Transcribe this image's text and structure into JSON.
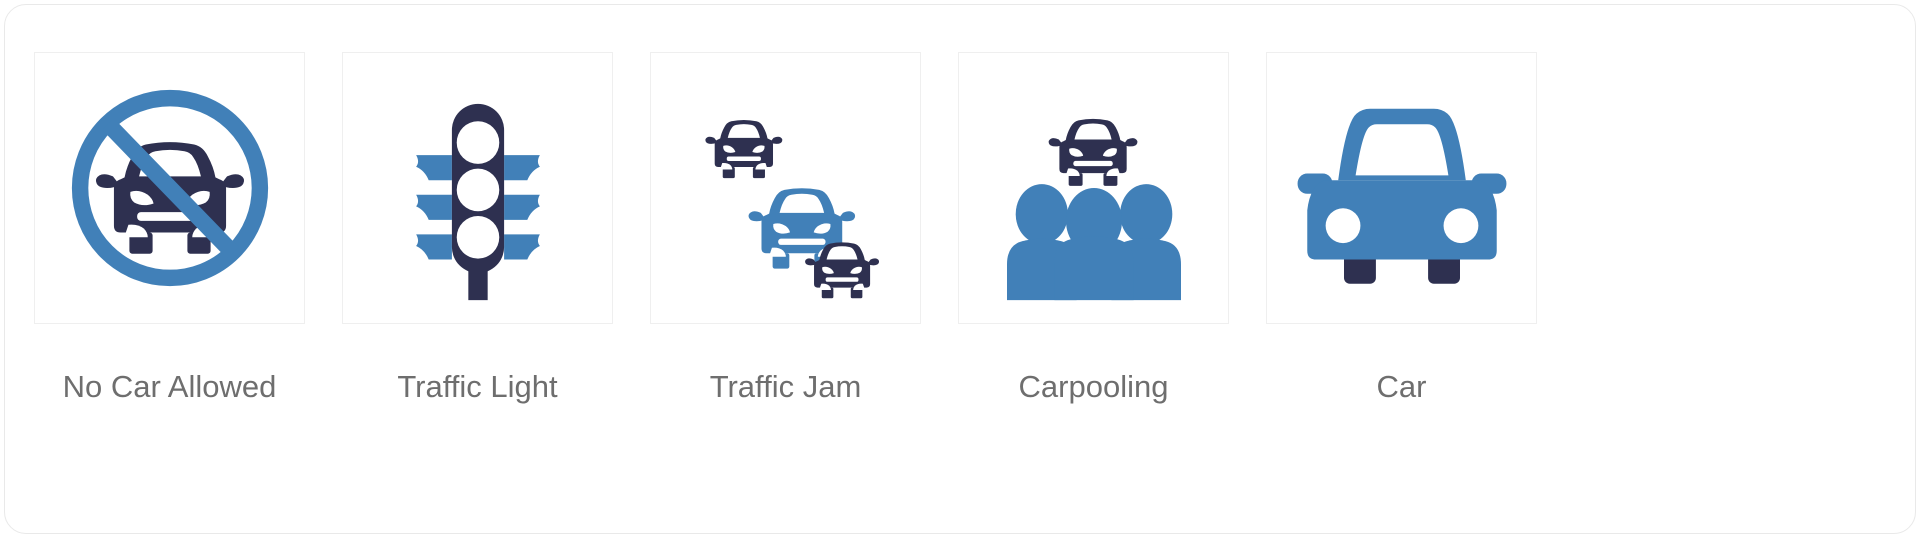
{
  "page": {
    "background": "#ffffff",
    "card_border": "#e9e9e9",
    "tile_border": "#efefef",
    "label_color": "#6e6e6e"
  },
  "palette": {
    "blue": "#4180b8",
    "navy": "#2e3050",
    "white": "#ffffff"
  },
  "icon_set": {
    "count": 5,
    "items": [
      {
        "id": "no-car-allowed",
        "label": "No Car Allowed",
        "icon_name": "no-car-allowed-icon",
        "primary_color": "#4180b8",
        "secondary_color": "#2e3050",
        "description": "Blue prohibition circle with diagonal slash over a dark navy car front"
      },
      {
        "id": "traffic-light",
        "label": "Traffic Light",
        "icon_name": "traffic-light-icon",
        "primary_color": "#2e3050",
        "secondary_color": "#4180b8",
        "description": "Dark navy traffic light housing with three white lamps, blue light rays on both sides and a pole"
      },
      {
        "id": "traffic-jam",
        "label": "Traffic Jam",
        "icon_name": "traffic-jam-icon",
        "primary_color": "#2e3050",
        "secondary_color": "#4180b8",
        "description": "Three cars staggered diagonally, dark navy top-left, blue in the middle, dark navy bottom-right"
      },
      {
        "id": "carpooling",
        "label": "Carpooling",
        "icon_name": "carpooling-icon",
        "primary_color": "#2e3050",
        "secondary_color": "#4180b8",
        "description": "Dark navy car above three blue people figures"
      },
      {
        "id": "car",
        "label": "Car",
        "icon_name": "car-icon",
        "primary_color": "#4180b8",
        "secondary_color": "#2e3050",
        "description": "Blue car front view with white windshield, two white round headlights and dark navy wheels"
      }
    ]
  }
}
